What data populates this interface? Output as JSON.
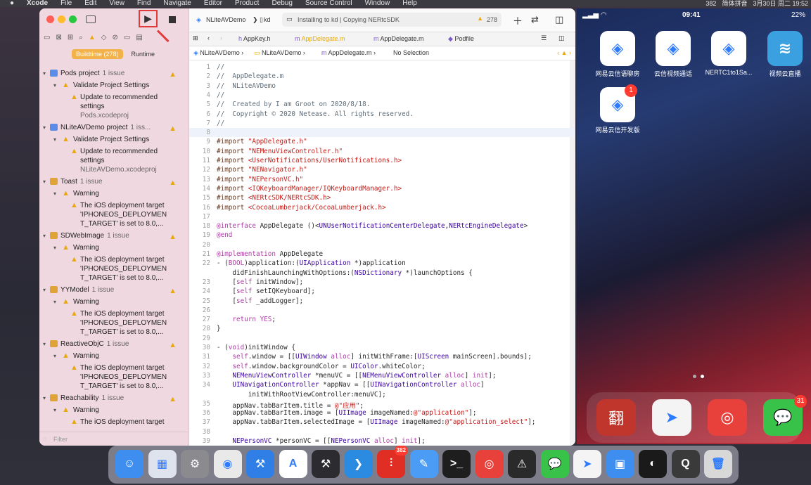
{
  "menubar": {
    "apple": "",
    "items": [
      "Xcode",
      "File",
      "Edit",
      "View",
      "Find",
      "Navigate",
      "Editor",
      "Product",
      "Debug",
      "Source Control",
      "Window",
      "Help"
    ],
    "badge_count": "382",
    "input_method": "简体拼音",
    "datetime": "3月30日 周二 19:52"
  },
  "toolbar": {
    "scheme": "NLiteAVDemo",
    "device": "kd",
    "activity": "Installing to kd | Copying NERtcSDK",
    "warning_count": "278"
  },
  "navigator": {
    "segments": [
      {
        "label": "Buildtime (278)",
        "active": true
      },
      {
        "label": "Runtime",
        "active": false
      }
    ],
    "filter_placeholder": "Filter"
  },
  "issues": [
    {
      "type": "project",
      "label": "Pods project",
      "count": "1 issue"
    },
    {
      "type": "group",
      "label": "Validate Project Settings"
    },
    {
      "type": "item",
      "lines": [
        "Update to recommended",
        "settings"
      ],
      "sub": "Pods.xcodeproj"
    },
    {
      "type": "project",
      "label": "NLiteAVDemo project",
      "count": "1 iss..."
    },
    {
      "type": "group",
      "label": "Validate Project Settings"
    },
    {
      "type": "item",
      "lines": [
        "Update to recommended",
        "settings"
      ],
      "sub": "NLiteAVDemo.xcodeproj"
    },
    {
      "type": "target",
      "label": "Toast",
      "count": "1 issue"
    },
    {
      "type": "group",
      "label": "Warning"
    },
    {
      "type": "item",
      "lines": [
        "The iOS deployment target",
        "'IPHONEOS_DEPLOYMEN",
        "T_TARGET' is set to 8.0,..."
      ]
    },
    {
      "type": "target",
      "label": "SDWebImage",
      "count": "1 issue"
    },
    {
      "type": "group",
      "label": "Warning"
    },
    {
      "type": "item",
      "lines": [
        "The iOS deployment target",
        "'IPHONEOS_DEPLOYMEN",
        "T_TARGET' is set to 8.0,..."
      ]
    },
    {
      "type": "target",
      "label": "YYModel",
      "count": "1 issue"
    },
    {
      "type": "group",
      "label": "Warning"
    },
    {
      "type": "item",
      "lines": [
        "The iOS deployment target",
        "'IPHONEOS_DEPLOYMEN",
        "T_TARGET' is set to 8.0,..."
      ]
    },
    {
      "type": "target",
      "label": "ReactiveObjC",
      "count": "1 issue"
    },
    {
      "type": "group",
      "label": "Warning"
    },
    {
      "type": "item",
      "lines": [
        "The iOS deployment target",
        "'IPHONEOS_DEPLOYMEN",
        "T_TARGET' is set to 8.0,..."
      ]
    },
    {
      "type": "target",
      "label": "Reachability",
      "count": "1 issue"
    },
    {
      "type": "group",
      "label": "Warning"
    },
    {
      "type": "item",
      "lines": [
        "The iOS deployment target"
      ]
    }
  ],
  "tabs": [
    "AppKey.h",
    "AppDelegate.m",
    "AppDelegate.m",
    "Podfile"
  ],
  "jumpbar": [
    "NLiteAVDemo",
    "NLiteAVDemo",
    "AppDelegate.m",
    "No Selection"
  ],
  "code_lines": [
    {
      "n": "1",
      "t": "//",
      "k": "com"
    },
    {
      "n": "2",
      "t": "//  AppDelegate.m",
      "k": "com"
    },
    {
      "n": "3",
      "t": "//  NLiteAVDemo",
      "k": "com"
    },
    {
      "n": "4",
      "t": "//",
      "k": "com"
    },
    {
      "n": "5",
      "t": "//  Created by I am Groot on 2020/8/18.",
      "k": "com"
    },
    {
      "n": "6",
      "t": "//  Copyright © 2020 Netease. All rights reserved.",
      "k": "com"
    },
    {
      "n": "7",
      "t": "//",
      "k": "com"
    },
    {
      "n": "8",
      "t": "",
      "k": "cur"
    },
    {
      "n": "9",
      "t": "#import \"AppDelegate.h\"",
      "k": "imp"
    },
    {
      "n": "10",
      "t": "#import \"NEMenuViewController.h\"",
      "k": "imp"
    },
    {
      "n": "11",
      "t": "#import <UserNotifications/UserNotifications.h>",
      "k": "imp"
    },
    {
      "n": "12",
      "t": "#import \"NENavigator.h\"",
      "k": "imp"
    },
    {
      "n": "13",
      "t": "#import \"NEPersonVC.h\"",
      "k": "imp"
    },
    {
      "n": "14",
      "t": "#import <IQKeyboardManager/IQKeyboardManager.h>",
      "k": "imp"
    },
    {
      "n": "15",
      "t": "#import <NERtcSDK/NERtcSDK.h>",
      "k": "imp"
    },
    {
      "n": "16",
      "t": "#import <CocoaLumberjack/CocoaLumberjack.h>",
      "k": "imp"
    },
    {
      "n": "17",
      "t": "",
      "k": "plain"
    },
    {
      "n": "18",
      "t": "@interface AppDelegate ()<UNUserNotificationCenterDelegate,NERtcEngineDelegate>",
      "k": "kw"
    },
    {
      "n": "19",
      "t": "@end",
      "k": "kw"
    },
    {
      "n": "20",
      "t": "",
      "k": "plain"
    },
    {
      "n": "21",
      "t": "@implementation AppDelegate",
      "k": "kw"
    },
    {
      "n": "22",
      "t": "- (BOOL)application:(UIApplication *)application",
      "k": "plain"
    },
    {
      "n": "",
      "t": "    didFinishLaunchingWithOptions:(NSDictionary *)launchOptions {",
      "k": "plain"
    },
    {
      "n": "23",
      "t": "    [self initWindow];",
      "k": "plain"
    },
    {
      "n": "24",
      "t": "    [self setIQKeyboard];",
      "k": "plain"
    },
    {
      "n": "25",
      "t": "    [self _addLogger];",
      "k": "plain"
    },
    {
      "n": "26",
      "t": "",
      "k": "plain"
    },
    {
      "n": "27",
      "t": "    return YES;",
      "k": "plain"
    },
    {
      "n": "28",
      "t": "}",
      "k": "plain"
    },
    {
      "n": "29",
      "t": "",
      "k": "plain"
    },
    {
      "n": "30",
      "t": "- (void)initWindow {",
      "k": "plain"
    },
    {
      "n": "31",
      "t": "    self.window = [[UIWindow alloc] initWithFrame:[UIScreen mainScreen].bounds];",
      "k": "plain"
    },
    {
      "n": "32",
      "t": "    self.window.backgroundColor = UIColor.whiteColor;",
      "k": "plain"
    },
    {
      "n": "33",
      "t": "    NEMenuViewController *menuVC = [[NEMenuViewController alloc] init];",
      "k": "plain"
    },
    {
      "n": "34",
      "t": "    UINavigationController *appNav = [[UINavigationController alloc]",
      "k": "plain"
    },
    {
      "n": "",
      "t": "        initWithRootViewController:menuVC];",
      "k": "plain"
    },
    {
      "n": "35",
      "t": "    appNav.tabBarItem.title = @\"应用\";",
      "k": "plain"
    },
    {
      "n": "36",
      "t": "    appNav.tabBarItem.image = [UIImage imageNamed:@\"application\"];",
      "k": "plain"
    },
    {
      "n": "37",
      "t": "    appNav.tabBarItem.selectedImage = [UIImage imageNamed:@\"application_select\"];",
      "k": "plain"
    },
    {
      "n": "38",
      "t": "",
      "k": "plain"
    },
    {
      "n": "39",
      "t": "    NEPersonVC *personVC = [[NEPersonVC alloc] init];",
      "k": "plain"
    }
  ],
  "simulator": {
    "time": "09:41",
    "battery": "22%",
    "apps": [
      {
        "label": "网易云信语聊房",
        "color": "#ffffff",
        "fg": "#2f7bff",
        "glyph": "◈"
      },
      {
        "label": "云信视频通话",
        "color": "#ffffff",
        "fg": "#2f7bff",
        "glyph": "◈"
      },
      {
        "label": "NERTC1to1Sa...",
        "color": "#ffffff",
        "fg": "#2f7bff",
        "glyph": "◈"
      },
      {
        "label": "视频云直播",
        "color": "#3aa0e0",
        "fg": "#ffffff",
        "glyph": "≋"
      },
      {
        "label": "网易云信开发版",
        "color": "#ffffff",
        "fg": "#2f7bff",
        "glyph": "◈",
        "badge": "1"
      }
    ],
    "dock": [
      {
        "color": "#c0362c",
        "glyph": "翻"
      },
      {
        "color": "#f4f4f4",
        "glyph": "➤"
      },
      {
        "color": "#e8413c",
        "glyph": "◎"
      },
      {
        "color": "#39c24a",
        "glyph": "💬",
        "badge": "31"
      }
    ]
  },
  "dock": {
    "apps": [
      {
        "name": "finder",
        "color": "#3e8ef0",
        "glyph": "☺"
      },
      {
        "name": "launchpad",
        "color": "#dfe3ee",
        "glyph": "▦"
      },
      {
        "name": "system-preferences",
        "color": "#8a8a8f",
        "glyph": "⚙"
      },
      {
        "name": "chrome",
        "color": "#e9e9e9",
        "glyph": "◉"
      },
      {
        "name": "xcode",
        "color": "#2f7fe6",
        "glyph": "⚒"
      },
      {
        "name": "app-store",
        "color": "#ffffff",
        "glyph": "A"
      },
      {
        "name": "instruments",
        "color": "#2c2c30",
        "glyph": "⚒"
      },
      {
        "name": "vscode",
        "color": "#2a8be0",
        "glyph": "❯"
      },
      {
        "name": "pinduoduo",
        "color": "#e02e24",
        "glyph": "⫶",
        "badge": "382"
      },
      {
        "name": "paw",
        "color": "#4b9cf5",
        "glyph": "✎"
      },
      {
        "name": "terminal",
        "color": "#1e1e1e",
        "glyph": ">_"
      },
      {
        "name": "netease-music",
        "color": "#e8413c",
        "glyph": "◎"
      },
      {
        "name": "console",
        "color": "#2a2a2a",
        "glyph": "⚠"
      },
      {
        "name": "wechat",
        "color": "#39c24a",
        "glyph": "💬"
      },
      {
        "name": "feishu",
        "color": "#f4f4f4",
        "glyph": "➤"
      },
      {
        "name": "simulator",
        "color": "#3e8ef0",
        "glyph": "▣"
      },
      {
        "name": "obs",
        "color": "#1a1a1a",
        "glyph": "◐"
      },
      {
        "name": "quicktime",
        "color": "#3a3a3a",
        "glyph": "Q"
      },
      {
        "name": "trash",
        "color": "#d8d8d8",
        "glyph": "🗑"
      }
    ]
  }
}
